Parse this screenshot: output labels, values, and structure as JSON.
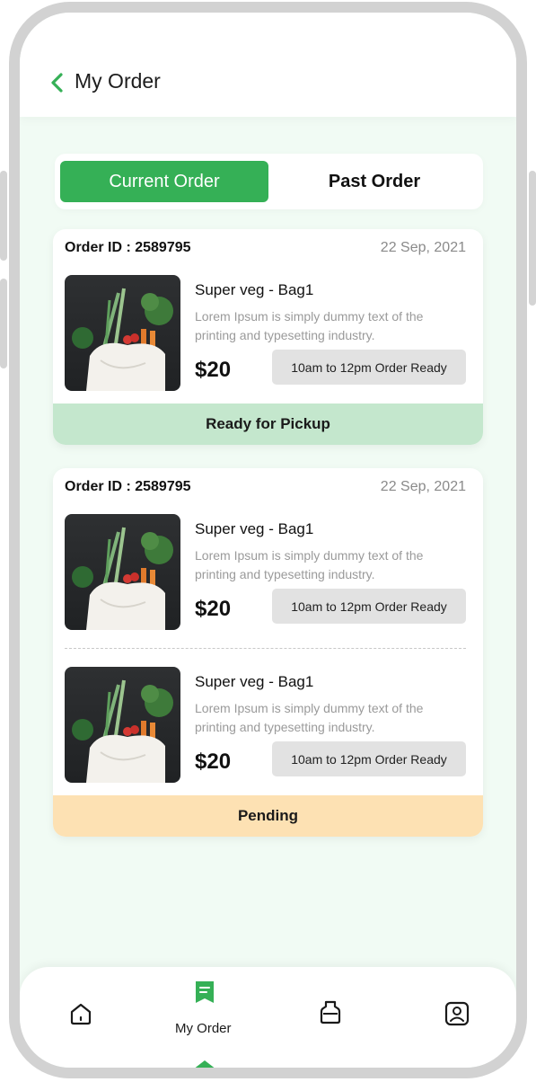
{
  "header": {
    "title": "My Order",
    "back_icon": "chevron-left-icon"
  },
  "tabs": [
    {
      "label": "Current Order",
      "active": true
    },
    {
      "label": "Past Order",
      "active": false
    }
  ],
  "orders": [
    {
      "order_id": "Order ID : 2589795",
      "date": "22 Sep, 2021",
      "items": [
        {
          "name": "Super veg - Bag1",
          "description": "Lorem Ipsum is simply dummy text of the printing and typesetting industry.",
          "price": "$20",
          "slot": "10am to 12pm Order Ready"
        }
      ],
      "status": "Ready for Pickup"
    },
    {
      "order_id": "Order ID : 2589795",
      "date": "22 Sep, 2021",
      "items": [
        {
          "name": "Super veg - Bag1",
          "description": "Lorem Ipsum is simply dummy text of the printing and typesetting industry.",
          "price": "$20",
          "slot": "10am to 12pm Order Ready"
        },
        {
          "name": "Super veg - Bag1",
          "description": "Lorem Ipsum is simply dummy text of the printing and typesetting industry.",
          "price": "$20",
          "slot": "10am to 12pm Order Ready"
        }
      ],
      "status": "Pending"
    }
  ],
  "nav": {
    "items": [
      {
        "icon": "home-icon"
      },
      {
        "icon": "receipt-icon",
        "label": "My Order",
        "active": true
      },
      {
        "icon": "bag-icon"
      },
      {
        "icon": "profile-icon"
      }
    ]
  },
  "colors": {
    "accent": "#35b056",
    "ready_status": "#c4e7cd",
    "pending_status": "#fde1b3",
    "background": "#f1fbf4"
  }
}
